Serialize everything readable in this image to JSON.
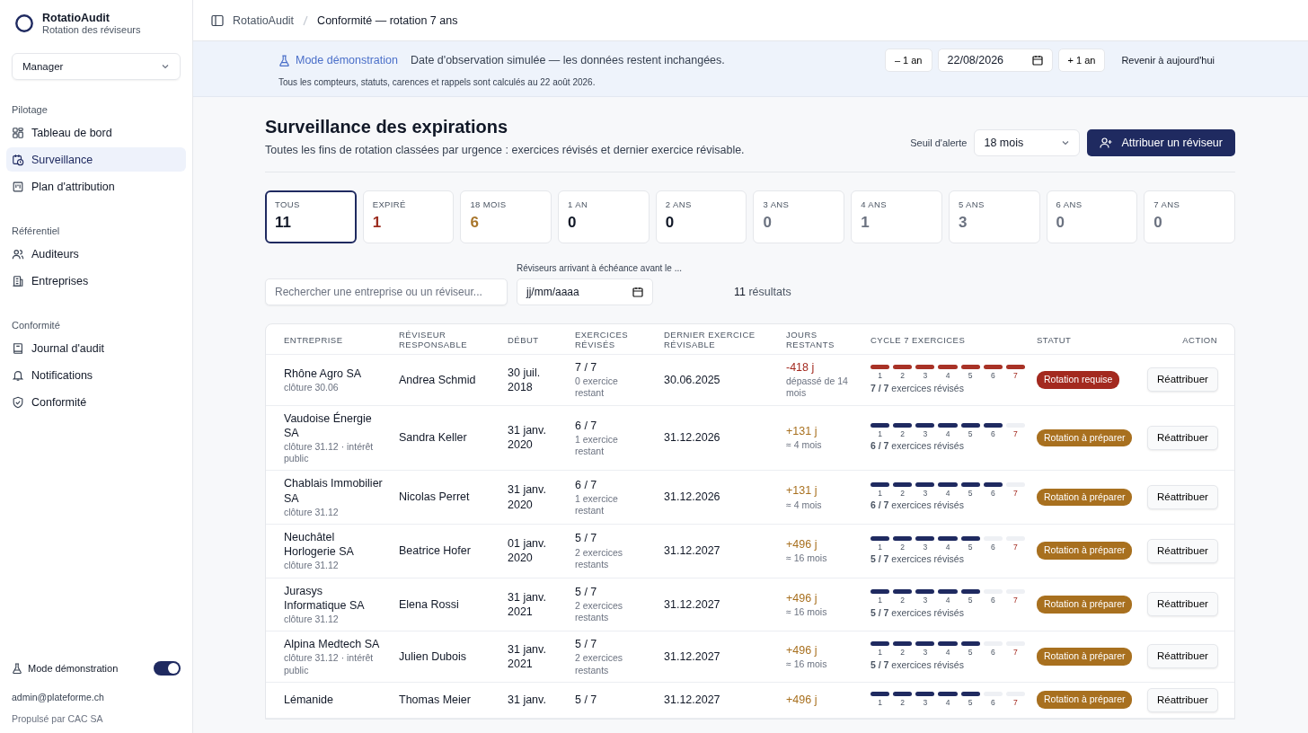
{
  "app": {
    "name": "RotatioAudit",
    "subtitle": "Rotation des réviseurs"
  },
  "role_select": {
    "value": "Manager"
  },
  "sidebar": {
    "sections": [
      {
        "title": "Pilotage",
        "items": [
          {
            "label": "Tableau de bord",
            "selected": false
          },
          {
            "label": "Surveillance",
            "selected": true
          },
          {
            "label": "Plan d'attribution",
            "selected": false
          }
        ]
      },
      {
        "title": "Référentiel",
        "items": [
          {
            "label": "Auditeurs",
            "selected": false
          },
          {
            "label": "Entreprises",
            "selected": false
          }
        ]
      },
      {
        "title": "Conformité",
        "items": [
          {
            "label": "Journal d'audit",
            "selected": false
          },
          {
            "label": "Notifications",
            "selected": false
          },
          {
            "label": "Conformité",
            "selected": false
          }
        ]
      }
    ],
    "demo_toggle": {
      "label": "Mode démonstration",
      "on": true
    },
    "email": "admin@plateforme.ch",
    "powered_by": "Propulsé par CAC SA"
  },
  "breadcrumb": [
    "RotatioAudit",
    "Conformité — rotation 7 ans"
  ],
  "demo_banner": {
    "title": "Mode démonstration",
    "message": "Date d'observation simulée — les données restent inchangées.",
    "note": "Tous les compteurs, statuts, carences et rappels sont calculés au 22 août 2026.",
    "minus_button": "– 1 an",
    "date_value": "22/08/2026",
    "plus_button": "+ 1 an",
    "reset_link": "Revenir à aujourd'hui"
  },
  "page": {
    "title": "Surveillance des expirations",
    "subtitle": "Toutes les fins de rotation classées par urgence : exercices révisés et dernier exercice révisable.",
    "threshold_label": "Seuil d'alerte",
    "threshold_value": "18 mois",
    "assign_button": "Attribuer un réviseur"
  },
  "counters": [
    {
      "label": "TOUS",
      "count": "11",
      "color": "#111827",
      "selected": true
    },
    {
      "label": "EXPIRÉ",
      "count": "1",
      "color": "#9b2c1f",
      "selected": false
    },
    {
      "label": "18 MOIS",
      "count": "6",
      "color": "#a8752a",
      "selected": false
    },
    {
      "label": "1 AN",
      "count": "0",
      "color": "#111827",
      "selected": false
    },
    {
      "label": "2 ANS",
      "count": "0",
      "color": "#111827",
      "selected": false
    },
    {
      "label": "3 ANS",
      "count": "0",
      "color": "#6b7280",
      "selected": false
    },
    {
      "label": "4 ANS",
      "count": "1",
      "color": "#6b7280",
      "selected": false
    },
    {
      "label": "5 ANS",
      "count": "3",
      "color": "#6b7280",
      "selected": false
    },
    {
      "label": "6 ANS",
      "count": "0",
      "color": "#6b7280",
      "selected": false
    },
    {
      "label": "7 ANS",
      "count": "0",
      "color": "#6b7280",
      "selected": false
    }
  ],
  "filters": {
    "search_placeholder": "Rechercher une entreprise ou un réviseur...",
    "date_label": "Réviseurs arrivant à échéance avant le ...",
    "date_placeholder": "jj/mm/aaaa",
    "result_count": "11",
    "result_label": "résultats"
  },
  "table": {
    "columns": [
      "ENTREPRISE",
      "RÉVISEUR RESPONSABLE",
      "DÉBUT",
      "EXERCICES RÉVISÉS",
      "DERNIER EXERCICE RÉVISABLE",
      "JOURS RESTANTS",
      "CYCLE 7 EXERCICES",
      "STATUT",
      "ACTION"
    ],
    "rows": [
      {
        "company": "Rhône Agro SA",
        "closing": "clôture 30.06",
        "reviewer": "Andrea Schmid",
        "start": "30 juil. 2018",
        "revised": "7 / 7",
        "remaining": "0 exercice restant",
        "last_year": "30.06.2025",
        "days": "-418 j",
        "days_note": "dépassé de 14 mois",
        "segments": [
          {
            "label": "1",
            "done": true
          },
          {
            "label": "2",
            "done": true
          },
          {
            "label": "3",
            "done": true
          },
          {
            "label": "4",
            "done": true
          },
          {
            "label": "5",
            "done": true
          },
          {
            "label": "6",
            "done": true
          },
          {
            "label": "7",
            "done": true
          }
        ],
        "cycle_summary": "**7 / 7** exercices révisés",
        "status": {
          "kind": "required",
          "label": "Rotation requise"
        },
        "action": "Réattribuer"
      },
      {
        "company": "Vaudoise Énergie SA",
        "closing": "clôture 31.12 · intérêt public",
        "reviewer": "Sandra Keller",
        "start": "31 janv. 2020",
        "revised": "6 / 7",
        "remaining": "1 exercice restant",
        "last_year": "31.12.2026",
        "days": "+131 j",
        "days_note": "≈ 4 mois",
        "segments": [
          {
            "label": "1",
            "done": true
          },
          {
            "label": "2",
            "done": true
          },
          {
            "label": "3",
            "done": true
          },
          {
            "label": "4",
            "done": true
          },
          {
            "label": "5",
            "done": true
          },
          {
            "label": "6",
            "done": true
          },
          {
            "label": "7",
            "done": false
          }
        ],
        "cycle_summary": "**6 / 7** exercices révisés",
        "status": {
          "kind": "prepare",
          "label": "Rotation à préparer"
        },
        "action": "Réattribuer"
      },
      {
        "company": "Chablais Immobilier SA",
        "closing": "clôture 31.12",
        "reviewer": "Nicolas Perret",
        "start": "31 janv. 2020",
        "revised": "6 / 7",
        "remaining": "1 exercice restant",
        "last_year": "31.12.2026",
        "days": "+131 j",
        "days_note": "≈ 4 mois",
        "segments": [
          {
            "label": "1",
            "done": true
          },
          {
            "label": "2",
            "done": true
          },
          {
            "label": "3",
            "done": true
          },
          {
            "label": "4",
            "done": true
          },
          {
            "label": "5",
            "done": true
          },
          {
            "label": "6",
            "done": true
          },
          {
            "label": "7",
            "done": false
          }
        ],
        "cycle_summary": "**6 / 7** exercices révisés",
        "status": {
          "kind": "prepare",
          "label": "Rotation à préparer"
        },
        "action": "Réattribuer"
      },
      {
        "company": "Neuchâtel Horlogerie SA",
        "closing": "clôture 31.12",
        "reviewer": "Beatrice Hofer",
        "start": "01 janv. 2020",
        "revised": "5 / 7",
        "remaining": "2 exercices restants",
        "last_year": "31.12.2027",
        "days": "+496 j",
        "days_note": "≈ 16 mois",
        "segments": [
          {
            "label": "1",
            "done": true
          },
          {
            "label": "2",
            "done": true
          },
          {
            "label": "3",
            "done": true
          },
          {
            "label": "4",
            "done": true
          },
          {
            "label": "5",
            "done": true
          },
          {
            "label": "6",
            "done": false
          },
          {
            "label": "7",
            "done": false
          }
        ],
        "cycle_summary": "**5 / 7** exercices révisés",
        "status": {
          "kind": "prepare",
          "label": "Rotation à préparer"
        },
        "action": "Réattribuer"
      },
      {
        "company": "Jurasys Informatique SA",
        "closing": "clôture 31.12",
        "reviewer": "Elena Rossi",
        "start": "31 janv. 2021",
        "revised": "5 / 7",
        "remaining": "2 exercices restants",
        "last_year": "31.12.2027",
        "days": "+496 j",
        "days_note": "≈ 16 mois",
        "segments": [
          {
            "label": "1",
            "done": true
          },
          {
            "label": "2",
            "done": true
          },
          {
            "label": "3",
            "done": true
          },
          {
            "label": "4",
            "done": true
          },
          {
            "label": "5",
            "done": true
          },
          {
            "label": "6",
            "done": false
          },
          {
            "label": "7",
            "done": false
          }
        ],
        "cycle_summary": "**5 / 7** exercices révisés",
        "status": {
          "kind": "prepare",
          "label": "Rotation à préparer"
        },
        "action": "Réattribuer"
      },
      {
        "company": "Alpina Medtech SA",
        "closing": "clôture 31.12 · intérêt public",
        "reviewer": "Julien Dubois",
        "start": "31 janv. 2021",
        "revised": "5 / 7",
        "remaining": "2 exercices restants",
        "last_year": "31.12.2027",
        "days": "+496 j",
        "days_note": "≈ 16 mois",
        "segments": [
          {
            "label": "1",
            "done": true
          },
          {
            "label": "2",
            "done": true
          },
          {
            "label": "3",
            "done": true
          },
          {
            "label": "4",
            "done": true
          },
          {
            "label": "5",
            "done": true
          },
          {
            "label": "6",
            "done": false
          },
          {
            "label": "7",
            "done": false
          }
        ],
        "cycle_summary": "**5 / 7** exercices révisés",
        "status": {
          "kind": "prepare",
          "label": "Rotation à préparer"
        },
        "action": "Réattribuer"
      },
      {
        "company": "Lémanide",
        "reviewer": "Thomas Meier",
        "start": "31 janv.",
        "revised": "5 / 7",
        "last_year": "31.12.2027",
        "days": "+496 j",
        "segments": [
          {
            "label": "1",
            "done": true
          },
          {
            "label": "2",
            "done": true
          },
          {
            "label": "3",
            "done": true
          },
          {
            "label": "4",
            "done": true
          },
          {
            "label": "5",
            "done": true
          },
          {
            "label": "6",
            "done": false
          },
          {
            "label": "7",
            "done": false
          }
        ],
        "status": {
          "kind": "prepare",
          "label": "Rotation à préparer"
        },
        "action": "Réattribuer"
      }
    ]
  }
}
